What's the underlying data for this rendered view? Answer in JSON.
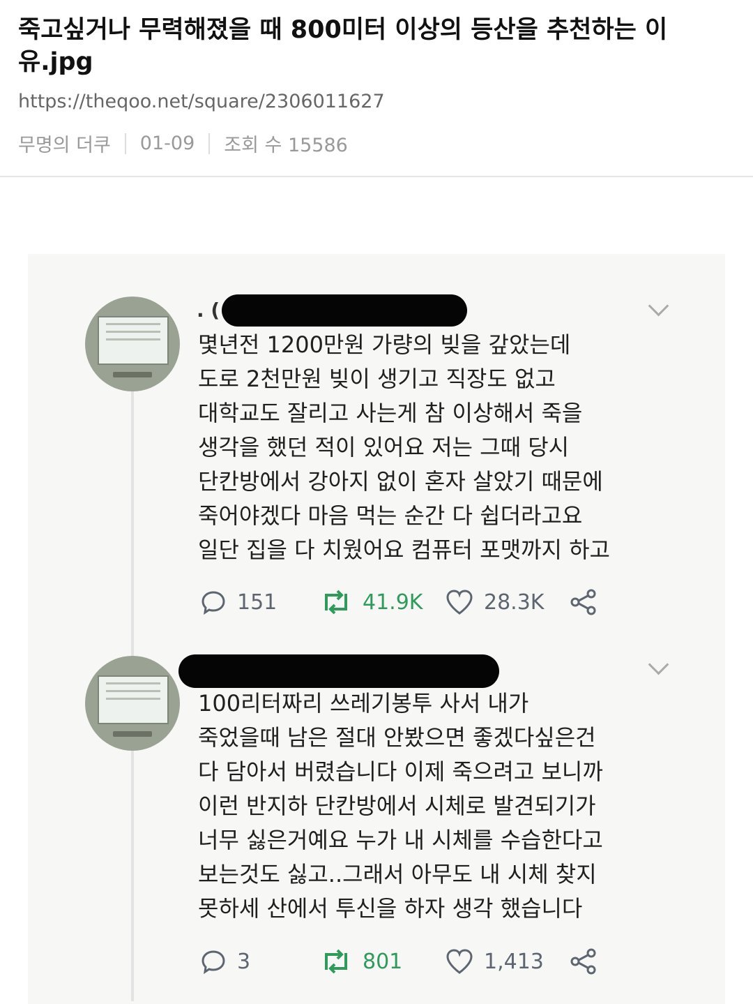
{
  "post": {
    "title": "죽고싶거나 무력해졌을 때 800미터 이상의 등산을 추천하는 이유.jpg",
    "url": "https://theqoo.net/square/2306011627",
    "author": "무명의 더쿠",
    "date": "01-09",
    "views_label": "조회 수 15586"
  },
  "tweets": [
    {
      "handle_prefix": ". (",
      "text": "몇년전 1200만원 가량의 빚을 갚았는데\n도로 2천만원 빚이 생기고 직장도 없고\n대학교도 잘리고 사는게 참 이상해서 죽을\n생각을 했던 적이 있어요 저는 그때 당시\n단칸방에서 강아지 없이 혼자 살았기 때문에\n죽어야겠다 마음 먹는 순간 다 쉽더라고요\n일단 집을 다 치웠어요 컴퓨터 포맷까지 하고",
      "replies": "151",
      "retweets": "41.9K",
      "likes": "28.3K"
    },
    {
      "handle_prefix": "",
      "text": "100리터짜리 쓰레기봉투 사서 내가\n죽었을때 남은 절대 안봤으면 좋겠다싶은건\n다 담아서 버렸습니다 이제 죽으려고 보니까\n이런 반지하 단칸방에서 시체로 발견되기가\n너무 싫은거예요 누가 내 시체를 수습한다고\n보는것도 싫고..그래서 아무도 내 시체 찾지\n못하세 산에서 투신을 하자 생각 했습니다",
      "replies": "3",
      "retweets": "801",
      "likes": "1,413"
    }
  ],
  "colors": {
    "retweet": "#2f9b5b",
    "icon_gray": "#5d6670"
  }
}
